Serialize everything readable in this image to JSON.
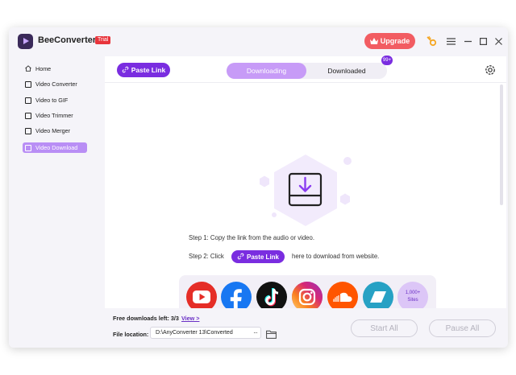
{
  "app": {
    "name": "BeeConverter",
    "badge": "Trial"
  },
  "titlebar": {
    "upgrade_label": "Upgrade"
  },
  "sidebar": {
    "items": [
      {
        "label": "Home"
      },
      {
        "label": "Video Converter"
      },
      {
        "label": "Video to GIF"
      },
      {
        "label": "Video Trimmer"
      },
      {
        "label": "Video Merger"
      },
      {
        "label": "Video Download"
      }
    ]
  },
  "toolbar": {
    "paste_link_label": "Paste Link",
    "tabs": [
      {
        "label": "Downloading"
      },
      {
        "label": "Downloaded"
      }
    ],
    "downloaded_count": "99+"
  },
  "instructions": {
    "step1": "Step 1: Copy the link from the audio or video.",
    "step2_prefix": "Step 2: Click",
    "step2_button": "Paste Link",
    "step2_suffix": "here to download from website."
  },
  "sites": {
    "icons": [
      "youtube-icon",
      "facebook-icon",
      "tiktok-icon",
      "instagram-icon",
      "soundcloud-icon",
      "vimeo-like-icon"
    ],
    "more_count": "1,000+",
    "more_label": "Sites"
  },
  "bottom": {
    "free_downloads": "Free downloads left: 3/3",
    "view_link": "View >",
    "location_label": "File location:",
    "location_value": "D:\\AnyConverter 13\\Converted",
    "start_all": "Start All",
    "pause_all": "Pause All"
  },
  "colors": {
    "accent": "#7a2de0",
    "accent_light": "#c79bf7",
    "upgrade": "#f25c62"
  }
}
